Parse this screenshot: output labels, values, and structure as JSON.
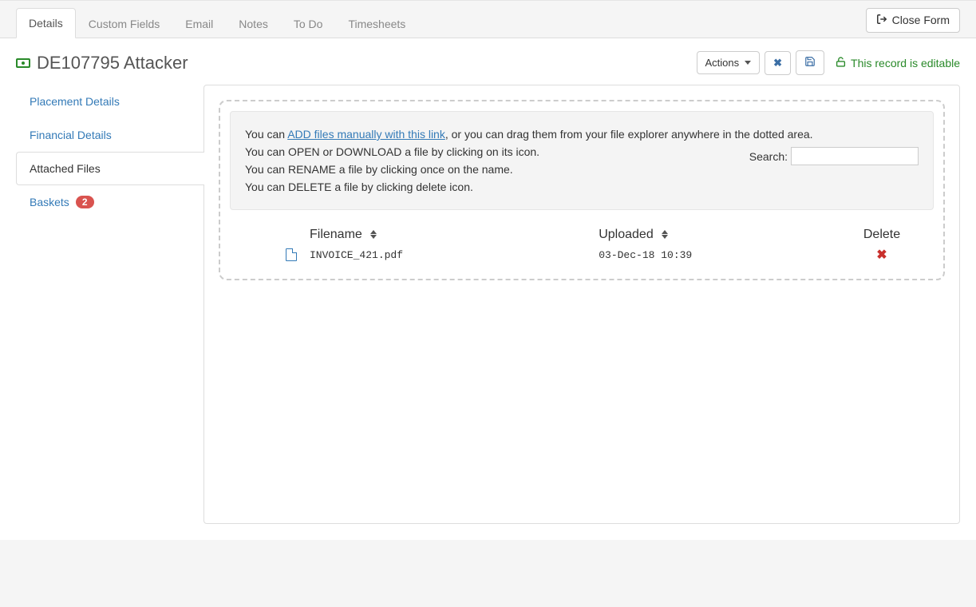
{
  "tabs": {
    "details": "Details",
    "custom_fields": "Custom Fields",
    "email": "Email",
    "notes": "Notes",
    "todo": "To Do",
    "timesheets": "Timesheets"
  },
  "close_form": "Close Form",
  "record_title": "DE107795 Attacker",
  "actions_label": "Actions",
  "editable_text": "This record is editable",
  "sidebar": {
    "placement": "Placement Details",
    "financial": "Financial Details",
    "attached": "Attached Files",
    "baskets": "Baskets",
    "baskets_count": "2"
  },
  "info": {
    "line1_a": "You can ",
    "line1_link": "ADD files manually with this link",
    "line1_b": ", or you can drag them from your file explorer anywhere in the dotted area.",
    "line2": "You can OPEN or DOWNLOAD a file by clicking on its icon.",
    "line3": "You can RENAME a file by clicking once on the name.",
    "line4": "You can DELETE a file by clicking delete icon."
  },
  "search_label": "Search:",
  "table": {
    "filename_header": "Filename",
    "uploaded_header": "Uploaded",
    "delete_header": "Delete"
  },
  "files": [
    {
      "name": "INVOICE_421.pdf",
      "uploaded": "03-Dec-18 10:39"
    }
  ]
}
